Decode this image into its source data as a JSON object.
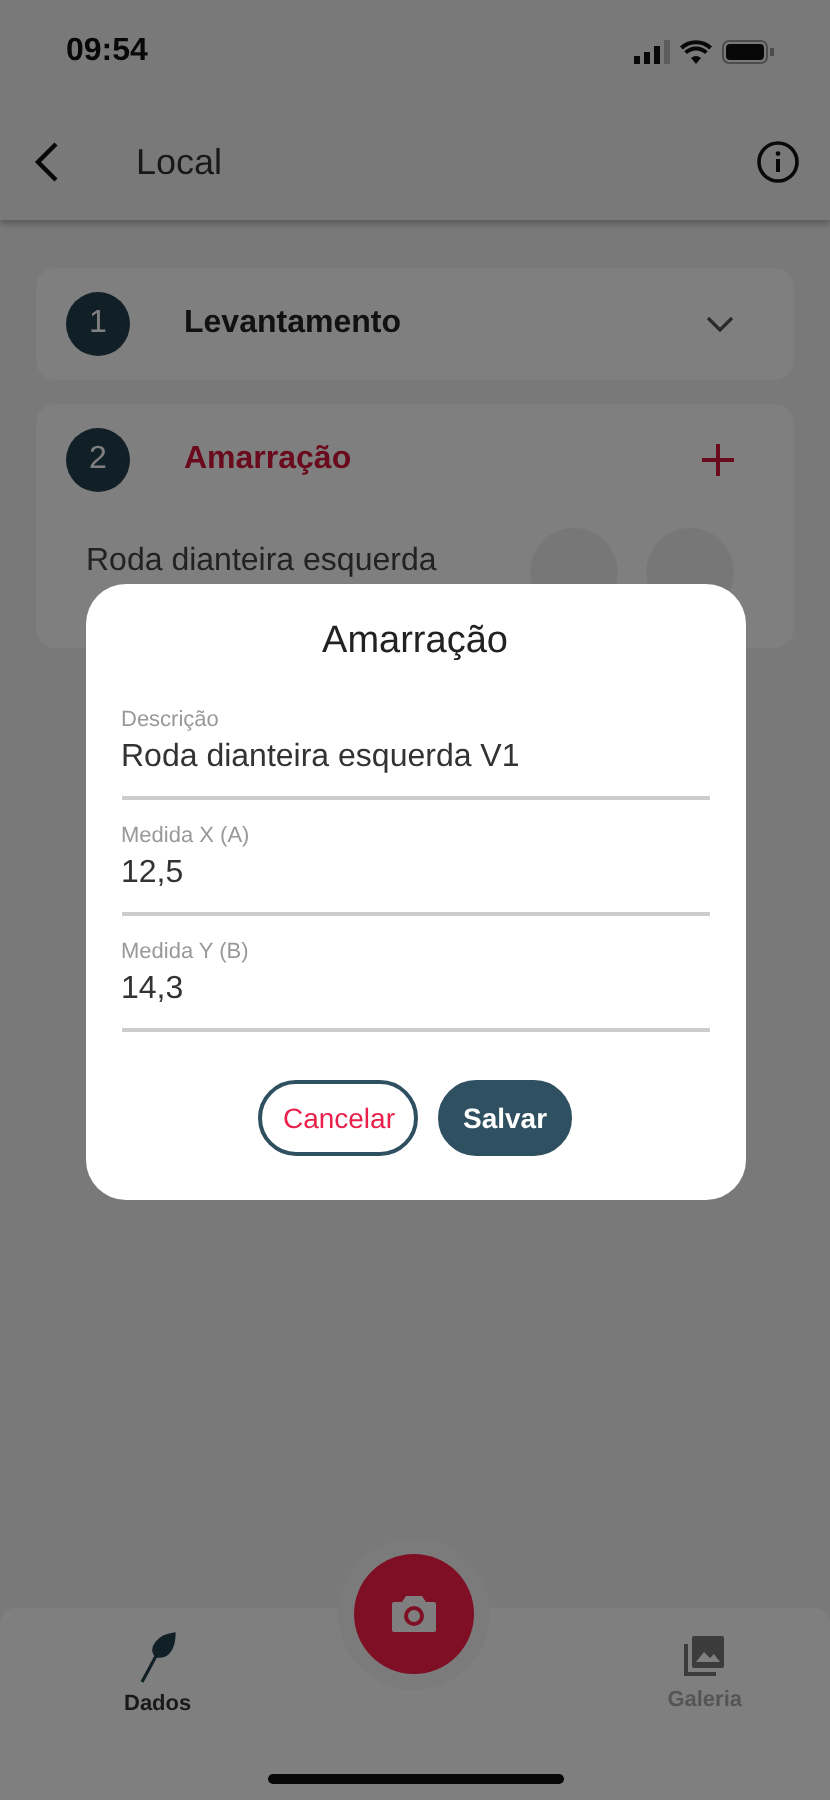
{
  "status_bar": {
    "time": "09:54"
  },
  "header": {
    "title": "Local"
  },
  "steps": [
    {
      "number": "1",
      "title": "Levantamento",
      "expanded": false,
      "selected": false
    },
    {
      "number": "2",
      "title": "Amarração",
      "expanded": true,
      "selected": true,
      "entries": [
        {
          "description": "Roda dianteira esquerda"
        }
      ]
    }
  ],
  "bottom_nav": [
    {
      "label": "Dados",
      "kind": "data",
      "selected": true
    },
    {
      "label": "Galeria",
      "kind": "gallery",
      "selected": false
    }
  ],
  "dialog": {
    "title": "Amarração",
    "fields": [
      {
        "label": "Descrição",
        "value": "Roda dianteira esquerda V1"
      },
      {
        "label": "Medida X (A)",
        "value": "12,5"
      },
      {
        "label": "Medida Y (B)",
        "value": "14,3"
      }
    ],
    "buttons": [
      {
        "label": "Cancelar",
        "kind": "outline"
      },
      {
        "label": "Salvar",
        "kind": "filled"
      }
    ]
  }
}
